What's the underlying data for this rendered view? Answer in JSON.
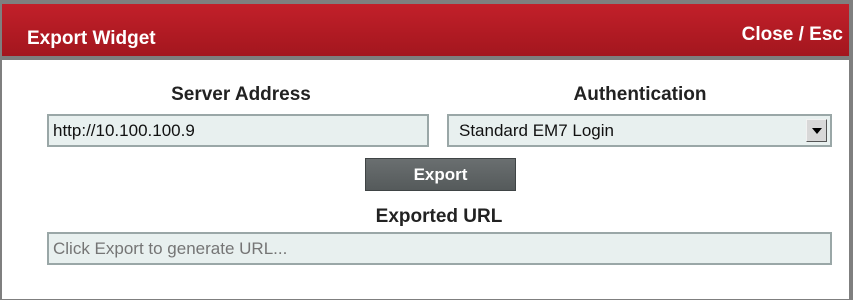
{
  "dialog": {
    "title": "Export Widget",
    "close_label": "Close / Esc"
  },
  "form": {
    "server_address": {
      "label": "Server Address",
      "value": "http://10.100.100.9"
    },
    "authentication": {
      "label": "Authentication",
      "selected": "Standard EM7 Login"
    },
    "export_button_label": "Export",
    "exported_url": {
      "label": "Exported URL",
      "placeholder": "Click Export to generate URL..."
    }
  },
  "colors": {
    "titlebar": "#b51c25",
    "frame": "#7f7f7f",
    "field_bg": "#e8f0ef",
    "button_bg": "#5e6364"
  },
  "icons": {
    "dropdown": "chevron-down-icon"
  }
}
